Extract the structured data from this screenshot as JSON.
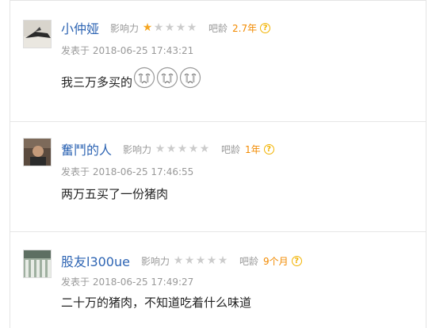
{
  "posts": [
    {
      "username": "小仲娅",
      "influence_label": "影响力",
      "stars_filled": 1,
      "stars_total": 5,
      "age_label": "吧龄",
      "age_value": "2.7年",
      "date_prefix": "发表于",
      "date": "2018-06-25 17:43:21",
      "content": "我三万多买的",
      "emoji": [
        "crying-face-icon",
        "crying-face-icon",
        "crying-face-icon"
      ]
    },
    {
      "username": "奮鬥的人",
      "influence_label": "影响力",
      "stars_filled": 0,
      "stars_total": 5,
      "age_label": "吧龄",
      "age_value": "1年",
      "date_prefix": "发表于",
      "date": "2018-06-25 17:46:55",
      "content": "两万五买了一份猪肉",
      "emoji": []
    },
    {
      "username": "股友l300ue",
      "influence_label": "影响力",
      "stars_filled": 0,
      "stars_total": 5,
      "age_label": "吧龄",
      "age_value": "9个月",
      "date_prefix": "发表于",
      "date": "2018-06-25 17:49:27",
      "content": "二十万的猪肉，不知道吃着什么味道",
      "emoji": []
    }
  ],
  "help_glyph": "?",
  "colors": {
    "username": "#2d64b3",
    "age": "#f28a00",
    "star_on": "#f5a623",
    "star_off": "#cccccc",
    "meta": "#999999"
  }
}
